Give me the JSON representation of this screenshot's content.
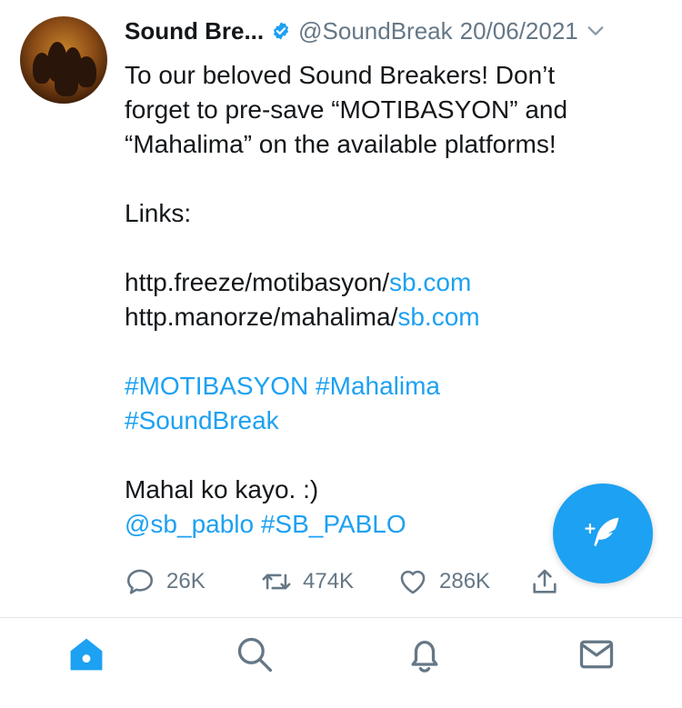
{
  "tweet": {
    "name": "Sound Bre...",
    "handle": "@SoundBreak",
    "date": "20/06/2021",
    "lines": {
      "l1": "To our beloved Sound Breakers! Don’t",
      "l2": "forget to pre-save “MOTIBASYON” and",
      "l3": "“Mahalima” on the available platforms!",
      "l4": "Links:",
      "link1_plain": "http.freeze/motibasyon/",
      "link1_blue": "sb.com",
      "link2_plain": "http.manorze/mahalima/",
      "link2_blue": "sb.com",
      "hashtags1": "#MOTIBASYON #Mahalima",
      "hashtags2": "#SoundBreak",
      "closing": "Mahal ko kayo. :)",
      "mentions": "@sb_pablo #SB_PABLO"
    },
    "stats": {
      "replies": "26K",
      "retweets": "474K",
      "likes": "286K"
    }
  },
  "colors": {
    "accent": "#1da1f2",
    "text": "#14171a",
    "muted": "#657786"
  },
  "icons": {
    "verified": "verified-badge-icon",
    "menu": "chevron-down-icon",
    "reply": "reply-bubble-icon",
    "retweet": "retweet-icon",
    "like": "heart-icon",
    "share": "share-icon",
    "compose": "compose-tweet-icon",
    "tabs": [
      "home-icon",
      "search-icon",
      "notifications-icon",
      "messages-icon"
    ]
  }
}
